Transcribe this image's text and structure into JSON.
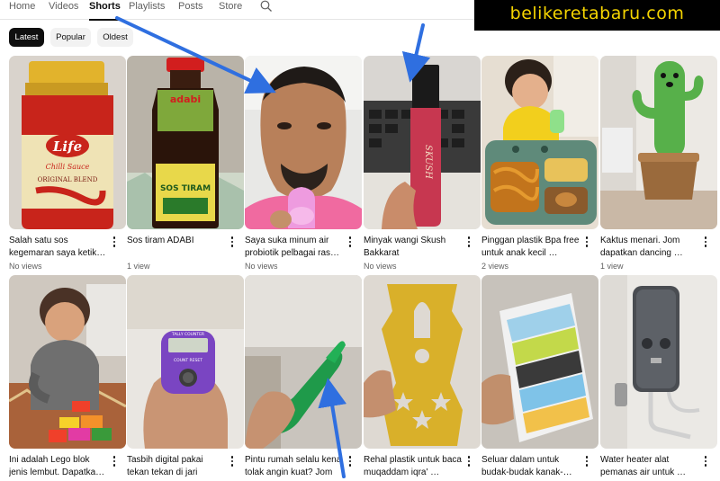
{
  "nav": {
    "tabs": [
      "Home",
      "Videos",
      "Shorts",
      "Playlists",
      "Posts",
      "Store"
    ],
    "active_tab": "Shorts",
    "search_icon": "search-icon"
  },
  "watermark": {
    "text": "belikeretabaru.com",
    "color": "#f5d400"
  },
  "chips": [
    "Latest",
    "Popular",
    "Oldest"
  ],
  "active_chip": "Latest",
  "shorts": [
    {
      "title": "Salah satu sos kegemaran saya ketik…",
      "views": "No views"
    },
    {
      "title": "Sos tiram ADABI",
      "views": "1 view"
    },
    {
      "title": "Saya suka minum air probiotik pelbagai ras…",
      "views": "No views"
    },
    {
      "title": "Minyak wangi Skush Bakkarat",
      "views": "No views"
    },
    {
      "title": "Pinggan plastik Bpa free untuk anak kecil …",
      "views": "2 views"
    },
    {
      "title": "Kaktus menari. Jom dapatkan dancing …",
      "views": "1 view"
    },
    {
      "title": "Ini adalah Lego blok jenis lembut. Dapatka…",
      "views": ""
    },
    {
      "title": "Tasbih digital pakai tekan tekan di jari",
      "views": ""
    },
    {
      "title": "Pintu rumah selalu kena tolak angin kuat? Jom …",
      "views": ""
    },
    {
      "title": "Rehal plastik untuk baca muqaddam iqra' …",
      "views": ""
    },
    {
      "title": "Seluar dalam untuk budak-budak kanak-…",
      "views": ""
    },
    {
      "title": "Water heater alat pemanas air untuk …",
      "views": ""
    }
  ],
  "thumb_text": {
    "sauce_brand": "Life",
    "sauce_line1": "Chilli Sauce",
    "sauce_line2": "ORIGINAL BLEND",
    "oyster_brand": "adabi",
    "oyster_label": "SOS TIRAM",
    "perfume_text": "SKUSH",
    "counter_text": "TALLY COUNTER",
    "counter_buttons": "COUNT  RESET"
  },
  "colors": {
    "accent_arrow": "#2f6fe0",
    "text_primary": "#0f0f0f",
    "text_secondary": "#606060"
  }
}
